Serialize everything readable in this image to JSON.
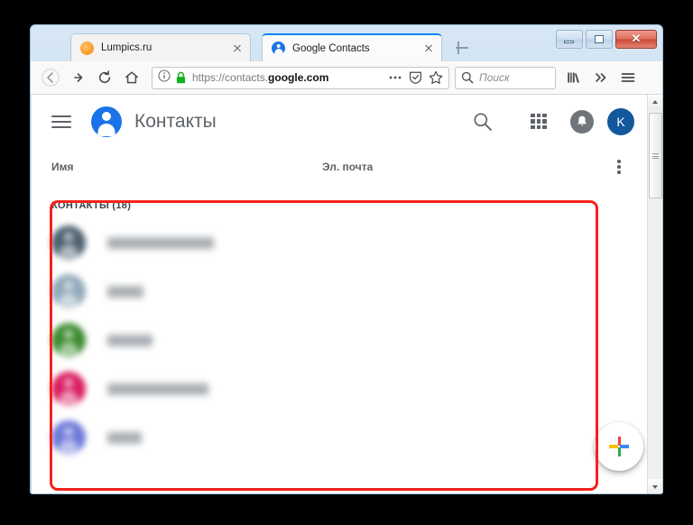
{
  "browser": {
    "tabs": [
      {
        "title": "Lumpics.ru",
        "favicon": "orange-circle-icon",
        "active": false
      },
      {
        "title": "Google Contacts",
        "favicon": "google-contacts-person-icon",
        "active": true
      }
    ],
    "new_tab_label": "+",
    "window_controls": {
      "minimize": "minimize-icon",
      "maximize": "maximize-icon",
      "close": "✕"
    },
    "toolbar": {
      "back_icon": "back-arrow-icon",
      "forward_icon": "forward-arrow-icon",
      "reload_icon": "reload-icon",
      "home_icon": "home-icon",
      "identity_icon": "info-icon",
      "lock_icon": "padlock-icon",
      "url_prefix": "https://contacts.",
      "url_domain": "google.com",
      "page_actions_icon": "ellipsis-icon",
      "tracking_shield_icon": "shield-icon",
      "bookmark_icon": "star-icon",
      "search_placeholder": "Поиск",
      "search_value": "",
      "library_icon": "library-icon",
      "overflow_icon": "double-chevron-icon",
      "menu_icon": "hamburger-menu-icon"
    }
  },
  "app": {
    "menu_icon": "hamburger-menu-icon",
    "logo_icon": "contacts-person-icon",
    "title": "Контакты",
    "search_icon": "search-icon",
    "apps_icon": "apps-grid-icon",
    "notifications_icon": "bell-icon",
    "account_initial": "K",
    "columns": {
      "name": "Имя",
      "email": "Эл. почта",
      "more_icon": "kebab-menu-icon"
    },
    "group_label": "КОНТАКТЫ (18)",
    "contact_count": 18,
    "contacts": [
      {
        "avatar_color": "#4a5f6e",
        "name_width": 118,
        "name": ""
      },
      {
        "avatar_color": "#8fa8ba",
        "name_width": 40,
        "name": ""
      },
      {
        "avatar_color": "#3b8b2e",
        "name_width": 50,
        "name": ""
      },
      {
        "avatar_color": "#d81b60",
        "name_width": 112,
        "name": ""
      },
      {
        "avatar_color": "#6d78d8",
        "name_width": 38,
        "name": ""
      }
    ],
    "fab": {
      "icon": "google-plus-add-icon",
      "colors": {
        "red": "#ea4335",
        "blue": "#4285f4",
        "green": "#34a853",
        "yellow": "#fbbc05"
      }
    }
  },
  "annotation": {
    "highlight_color": "#f5221b"
  }
}
